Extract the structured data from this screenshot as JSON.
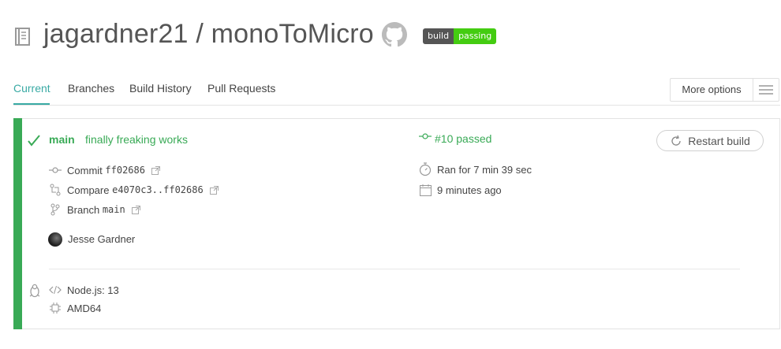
{
  "header": {
    "owner": "jagardner21",
    "separator": "/",
    "repo": "monoToMicro",
    "badge": {
      "left": "build",
      "right": "passing"
    }
  },
  "tabs": [
    {
      "label": "Current",
      "active": true
    },
    {
      "label": "Branches",
      "active": false
    },
    {
      "label": "Build History",
      "active": false
    },
    {
      "label": "Pull Requests",
      "active": false
    }
  ],
  "more_options": {
    "label": "More options"
  },
  "build": {
    "status_color": "#39aa56",
    "branch": "main",
    "message": "finally freaking works",
    "number_status": "#10 passed",
    "restart_label": "Restart build",
    "commit": {
      "label": "Commit",
      "value": "ff02686"
    },
    "compare": {
      "label": "Compare",
      "value": "e4070c3..ff02686"
    },
    "branch_row": {
      "label": "Branch",
      "value": "main"
    },
    "duration": "Ran for 7 min 39 sec",
    "finished": "9 minutes ago",
    "author": "Jesse Gardner",
    "language": "Node.js: 13",
    "arch": "AMD64"
  },
  "colors": {
    "accent_tab": "#39aaa4",
    "passed": "#39aa56",
    "badge_green": "#44cc11"
  },
  "icons": [
    "repo-book-icon",
    "github-icon",
    "check-icon",
    "commit-icon",
    "compare-icon",
    "branch-icon",
    "external-link-icon",
    "build-number-icon",
    "stopwatch-icon",
    "calendar-icon",
    "restart-icon",
    "linux-icon",
    "code-icon",
    "cpu-icon",
    "hamburger-icon"
  ]
}
